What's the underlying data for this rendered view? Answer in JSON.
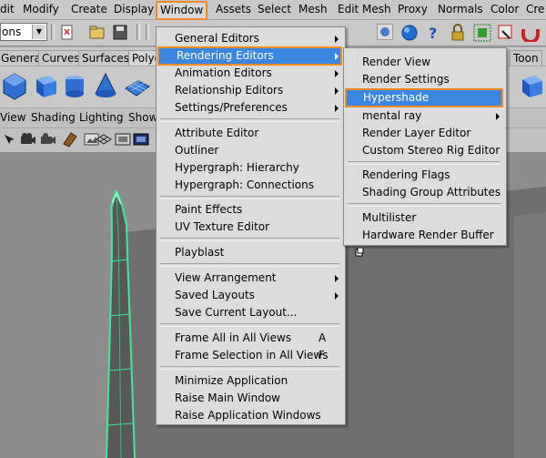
{
  "menubar": {
    "items": [
      "dit",
      "Modify",
      "Create",
      "Display",
      "Window",
      "Assets",
      "Select",
      "Mesh",
      "Edit Mesh",
      "Proxy",
      "Normals",
      "Color",
      "Cre"
    ]
  },
  "toolbar": {
    "combo_value": "ons"
  },
  "shelf": {
    "tabs": [
      "eneral",
      "General",
      "Curves",
      "Surfaces",
      "Polyg",
      "Toon"
    ]
  },
  "panel_menu": {
    "items": [
      "View",
      "Shading",
      "Lighting",
      "Show"
    ]
  },
  "window_menu": {
    "items": [
      "General Editors",
      "Rendering Editors",
      "Animation Editors",
      "Relationship Editors",
      "Settings/Preferences",
      "Attribute Editor",
      "Outliner",
      "Hypergraph: Hierarchy",
      "Hypergraph: Connections",
      "Paint Effects",
      "UV Texture Editor",
      "Playblast",
      "View Arrangement",
      "Saved Layouts",
      "Save Current Layout...",
      "Frame All in All Views",
      "Frame Selection in All Views",
      "Minimize Application",
      "Raise Main Window",
      "Raise Application Windows"
    ],
    "shortcuts": {
      "frame_all": "A",
      "frame_selection": "F"
    }
  },
  "rendering_submenu": {
    "items": [
      "Render View",
      "Render Settings",
      "Hypershade",
      "mental ray",
      "Render Layer Editor",
      "Custom Stereo Rig Editor",
      "Rendering Flags",
      "Shading Group Attributes",
      "Multilister",
      "Hardware Render Buffer"
    ]
  },
  "colors": {
    "highlight": "#3a86e0",
    "callout": "#f08a24",
    "viewport": "#8d8d8d",
    "selection_wire": "#3fe89a"
  },
  "icons": [
    "down-arrow-icon",
    "new-scene-icon",
    "open-scene-icon",
    "save-scene-icon",
    "snap-icon",
    "render-globe-icon",
    "help-icon",
    "lock-icon",
    "select-icon",
    "magnet-icon",
    "cube-icon",
    "sphere-icon",
    "cone-icon",
    "plane-icon"
  ]
}
